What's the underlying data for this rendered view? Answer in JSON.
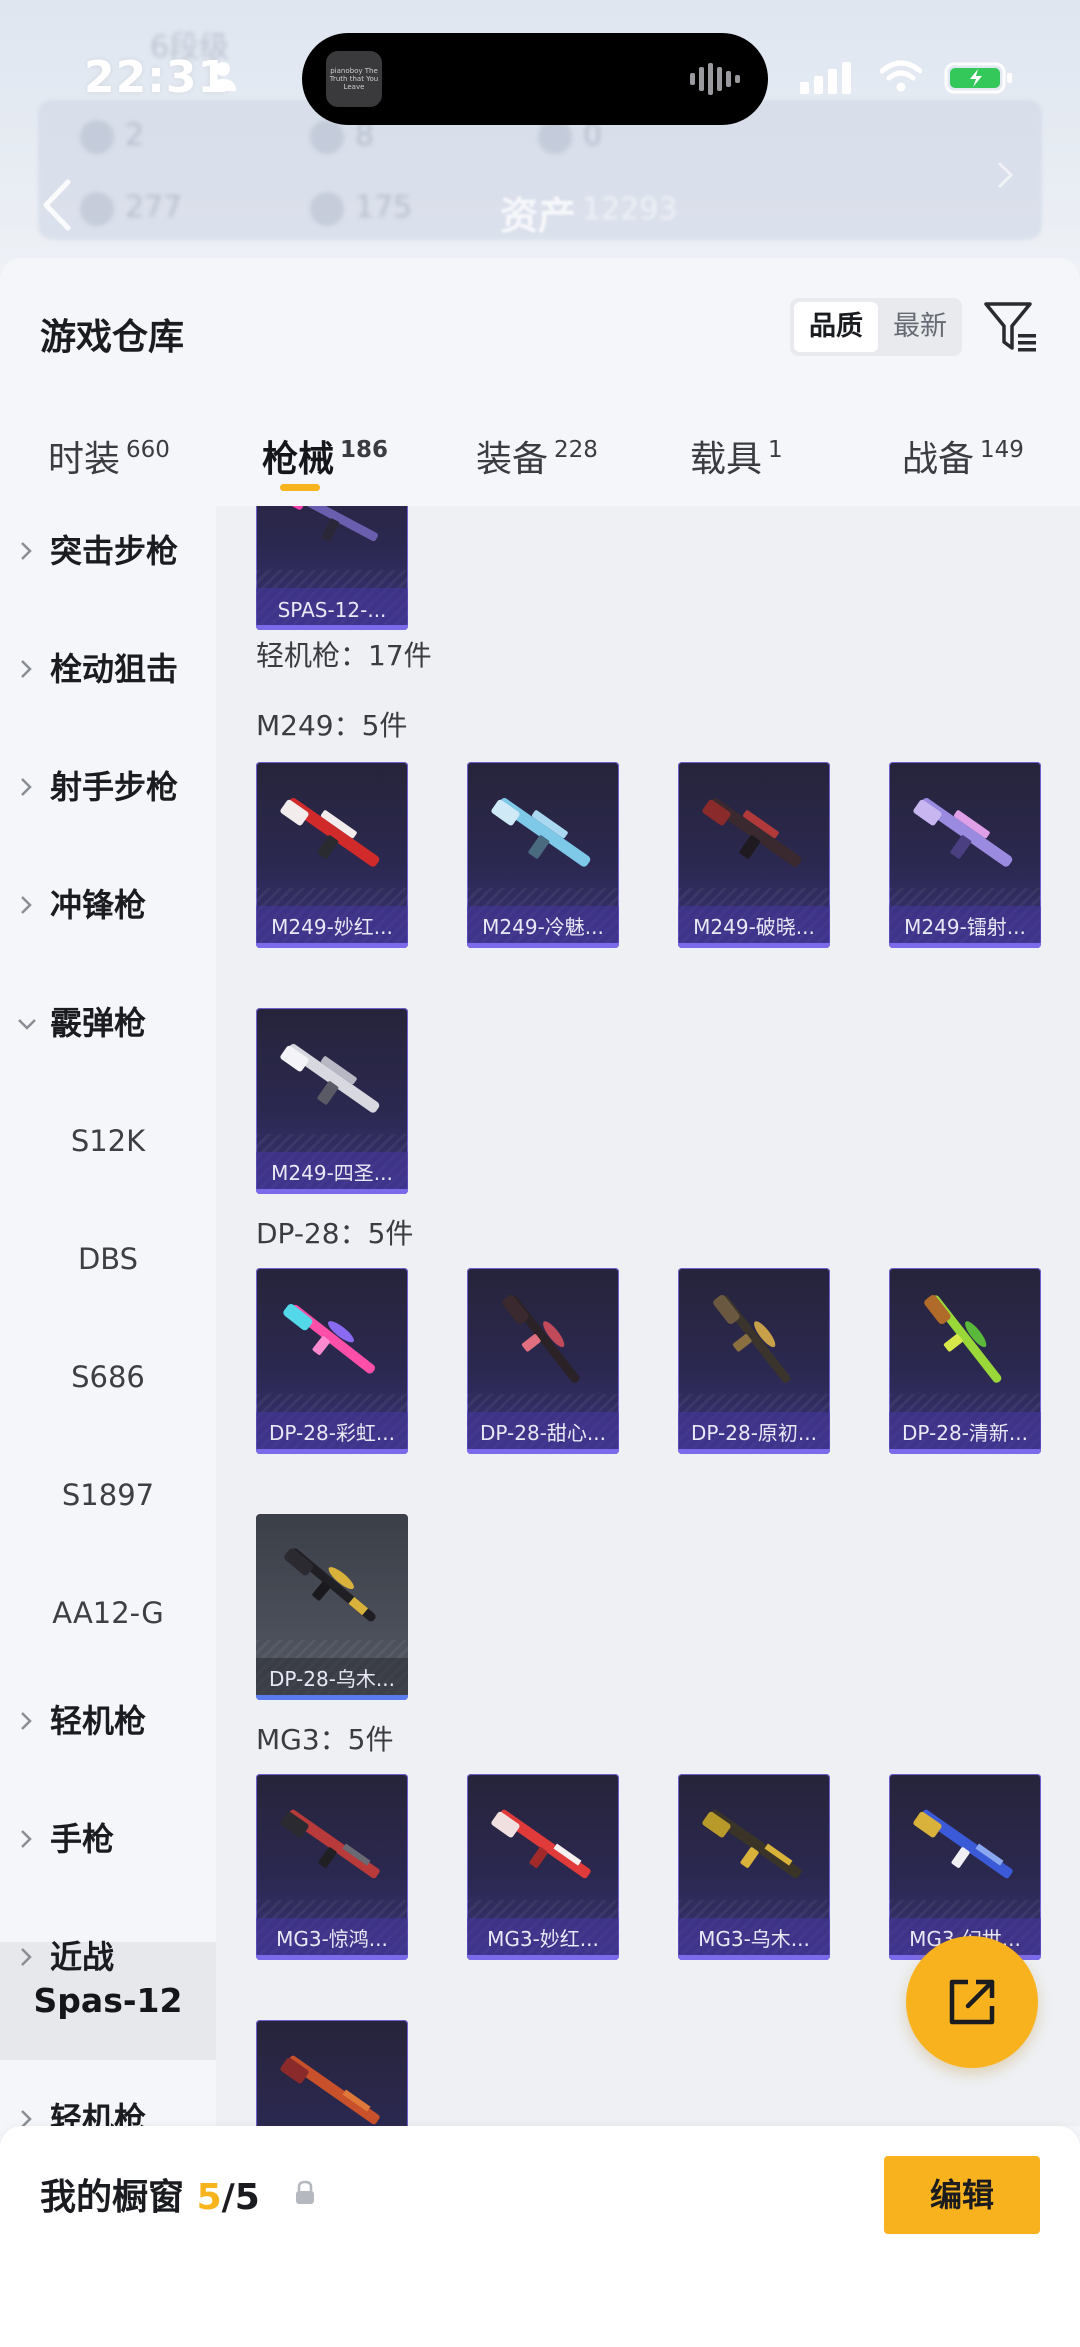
{
  "status_bar": {
    "time": "22:31"
  },
  "island": {
    "thumb_text": "pianoboy The Truth that You Leave"
  },
  "background": {
    "asset_label": "资产",
    "asset_value": "12293",
    "faded_rank": "6段级",
    "stats": [
      "2",
      "8",
      "0",
      "277",
      "175"
    ]
  },
  "header": {
    "title": "游戏仓库",
    "sort_quality": "品质",
    "sort_newest": "最新"
  },
  "tabs": [
    {
      "label": "时装",
      "count": "660"
    },
    {
      "label": "枪械",
      "count": "186"
    },
    {
      "label": "装备",
      "count": "228"
    },
    {
      "label": "载具",
      "count": "1"
    },
    {
      "label": "战备",
      "count": "149"
    }
  ],
  "sidebar": {
    "items": [
      {
        "label": "突击步枪"
      },
      {
        "label": "栓动狙击"
      },
      {
        "label": "射手步枪"
      },
      {
        "label": "冲锋枪"
      },
      {
        "label": "霰弹枪"
      }
    ],
    "subitems": [
      "S12K",
      "DBS",
      "S686",
      "S1897",
      "AA12-G"
    ],
    "active": "Spas-12",
    "items_after": [
      {
        "label": "轻机枪"
      },
      {
        "label": "手枪"
      },
      {
        "label": "近战"
      }
    ]
  },
  "content": {
    "top_card": "SPAS-12-...",
    "category_count": "轻机枪：17件",
    "groups": [
      {
        "title": "M249：5件",
        "items": [
          "M249-妙红...",
          "M249-冷魅...",
          "M249-破晓...",
          "M249-镭射...",
          "M249-四圣..."
        ]
      },
      {
        "title": "DP-28：5件",
        "items": [
          "DP-28-彩虹...",
          "DP-28-甜心...",
          "DP-28-原初...",
          "DP-28-清新...",
          "DP-28-乌木..."
        ]
      },
      {
        "title": "MG3：5件",
        "items": [
          "MG3-惊鸿...",
          "MG3-妙红...",
          "MG3-乌木...",
          "MG3-幻世..."
        ]
      }
    ]
  },
  "bottom": {
    "title": "我的橱窗",
    "count": "5",
    "total": "/5",
    "edit_label": "编辑"
  },
  "colors": {
    "accent": "#f7b41c",
    "card_purple": "#3a3378"
  }
}
